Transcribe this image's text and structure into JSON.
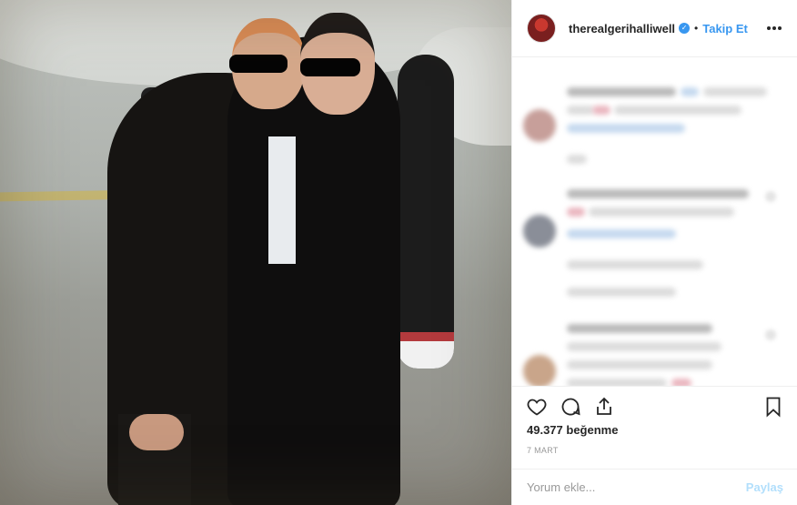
{
  "post": {
    "photo_alt": "",
    "colors": {
      "accent": "#3897f0",
      "text": "#262626",
      "muted": "#999999",
      "divider": "#efefef"
    }
  },
  "header": {
    "username": "therealgerihalliwell",
    "verified_icon": "verified-badge-icon",
    "separator": "•",
    "follow_label": "Takip Et",
    "more_icon": "more-options-icon"
  },
  "actions": {
    "like_icon": "heart-icon",
    "comment_icon": "comment-bubble-icon",
    "share_icon": "share-icon",
    "save_icon": "bookmark-icon"
  },
  "likes": {
    "text": "49.377 beğenme"
  },
  "date": {
    "text": "7 MART"
  },
  "add_comment": {
    "placeholder": "Yorum ekle...",
    "post_label": "Paylaş"
  }
}
